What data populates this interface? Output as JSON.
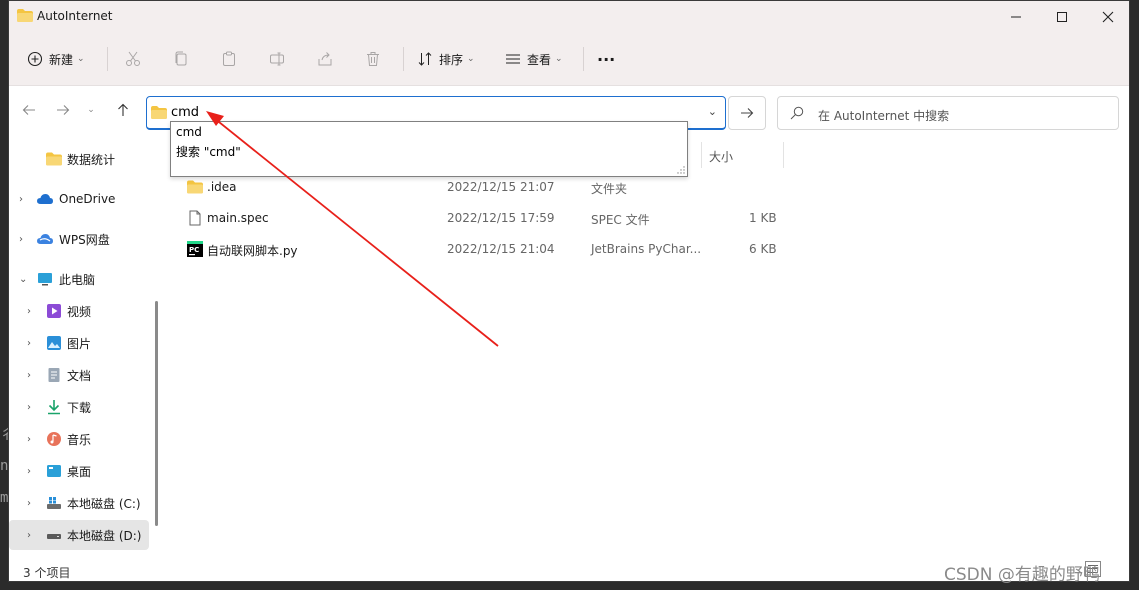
{
  "window": {
    "title": "AutoInternet"
  },
  "toolbar": {
    "new_label": "新建",
    "sort_label": "排序",
    "view_label": "查看",
    "more_label": "···"
  },
  "nav": {
    "address_value": "cmd",
    "search_placeholder": "在 AutoInternet 中搜索"
  },
  "suggestions": [
    {
      "label": "cmd"
    },
    {
      "label": "搜索 \"cmd\""
    }
  ],
  "sidebar": {
    "items": [
      {
        "label": "数据统计"
      },
      {
        "label": "OneDrive"
      },
      {
        "label": "WPS网盘"
      },
      {
        "label": "此电脑"
      },
      {
        "label": "视频"
      },
      {
        "label": "图片"
      },
      {
        "label": "文档"
      },
      {
        "label": "下载"
      },
      {
        "label": "音乐"
      },
      {
        "label": "桌面"
      },
      {
        "label": "本地磁盘 (C:)"
      },
      {
        "label": "本地磁盘 (D:)"
      }
    ]
  },
  "columns": {
    "size": "大小"
  },
  "files": [
    {
      "name": ".idea",
      "modified": "2022/12/15 21:07",
      "type": "文件夹",
      "size": ""
    },
    {
      "name": "main.spec",
      "modified": "2022/12/15 17:59",
      "type": "SPEC 文件",
      "size": "1 KB"
    },
    {
      "name": "自动联网脚本.py",
      "modified": "2022/12/15 21:04",
      "type": "JetBrains PyChar...",
      "size": "6 KB"
    }
  ],
  "status": {
    "item_count": "3 个项目"
  },
  "watermark": "CSDN @有趣的野鸭",
  "colors": {
    "accent": "#1e6fcf",
    "annotation_arrow": "#e8201a",
    "folder": "#f4c542"
  }
}
